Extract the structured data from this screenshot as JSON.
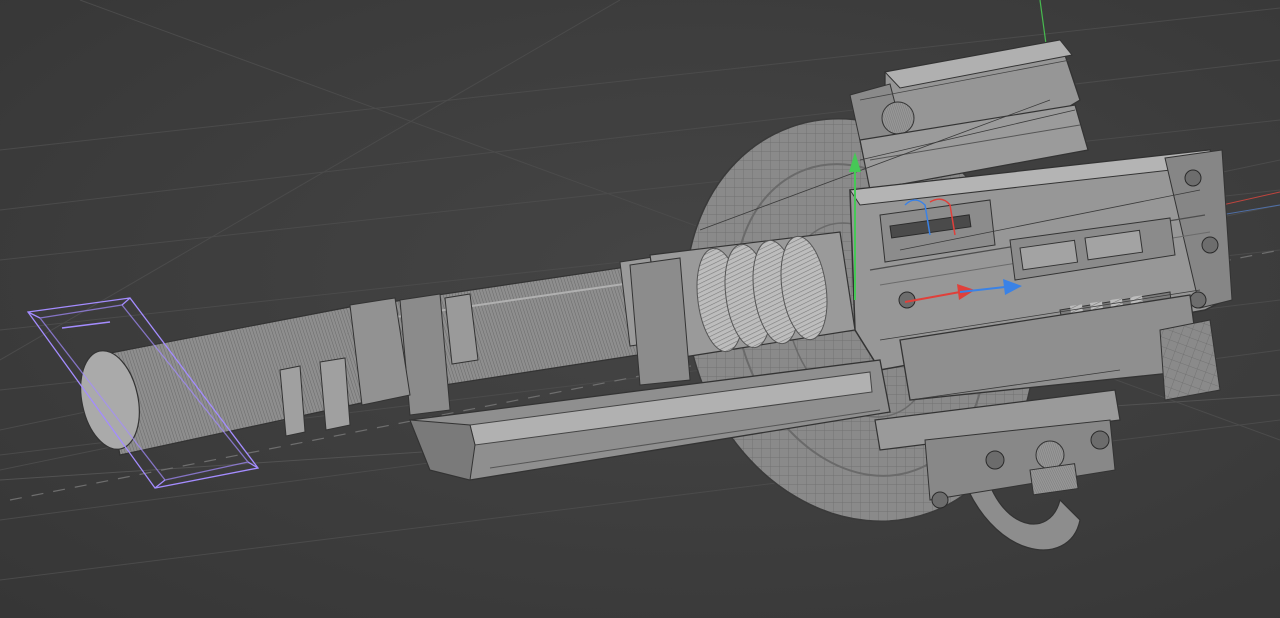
{
  "viewport": {
    "mode": "3d-perspective",
    "display": "wireframe-on-shaded",
    "background": "#3c3c3c",
    "grid": true
  },
  "colors": {
    "mesh_fill": "#8d8d8d",
    "mesh_light": "#a8a8a8",
    "mesh_dark": "#5e5e5e",
    "wire": "#2f2f2f",
    "selection": "#a48cff",
    "axis_x": "#e0403a",
    "axis_y": "#46c856",
    "axis_z": "#3a82e6",
    "grid": "#4a4a4a"
  },
  "scene": {
    "object": "mechanical-rifle-assembly",
    "selected_part": "barrel-tip-bounding-box"
  },
  "gizmo": {
    "type": "move",
    "axes": [
      "x-axis",
      "y-axis",
      "z-axis"
    ]
  }
}
